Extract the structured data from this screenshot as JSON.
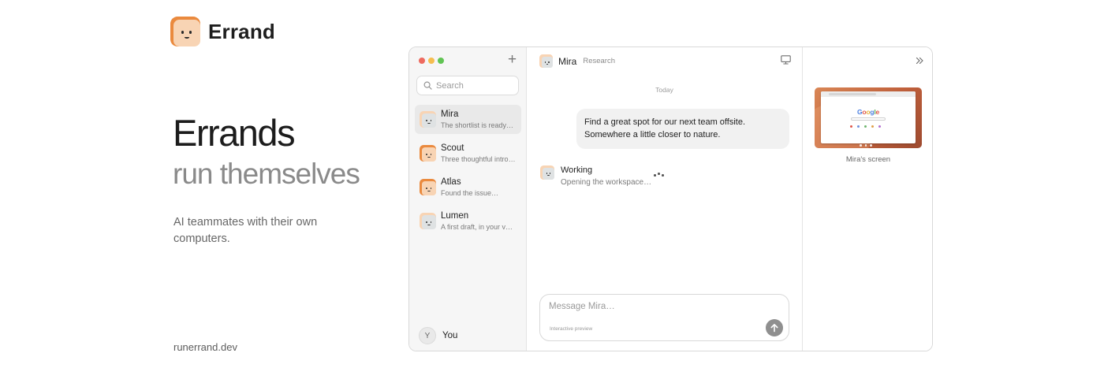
{
  "brand": {
    "name": "Errand"
  },
  "hero": {
    "title": "Errands",
    "subtitle": "run themselves",
    "description": "AI teammates with their own computers.",
    "link": "runerrand.dev"
  },
  "colors": {
    "traffic_red": "#ee6a5f",
    "traffic_yellow": "#f5bd4f",
    "traffic_green": "#61c454",
    "avatar_orange": "#ea8a3e",
    "avatar_peach": "#f8d4b4"
  },
  "sidebar": {
    "new_icon": "plus-icon",
    "search": {
      "placeholder": "Search",
      "value": ""
    },
    "conversations": [
      {
        "name": "Mira",
        "preview": "The shortlist is ready…",
        "active": true
      },
      {
        "name": "Scout",
        "preview": "Three thoughtful intros…",
        "active": false
      },
      {
        "name": "Atlas",
        "preview": "Found the issue…",
        "active": false
      },
      {
        "name": "Lumen",
        "preview": "A first draft, in your voice.",
        "active": false
      }
    ],
    "user": {
      "initial": "Y",
      "label": "You"
    }
  },
  "chat": {
    "agent_name": "Mira",
    "agent_tag": "Research",
    "screen_icon": "monitor-icon",
    "day_label": "Today",
    "user_message": "Find a great spot for our next team offsite. Somewhere a little closer to nature.",
    "status": {
      "title": "Working",
      "detail": "Opening the workspace…"
    },
    "composer": {
      "placeholder": "Message Mira…",
      "hint": "Interactive preview",
      "send_icon": "arrow-up-icon"
    }
  },
  "panel": {
    "collapse_icon": "double-chevron-right-icon",
    "screen_label": "Mira's screen",
    "preview_logo": "Google"
  }
}
